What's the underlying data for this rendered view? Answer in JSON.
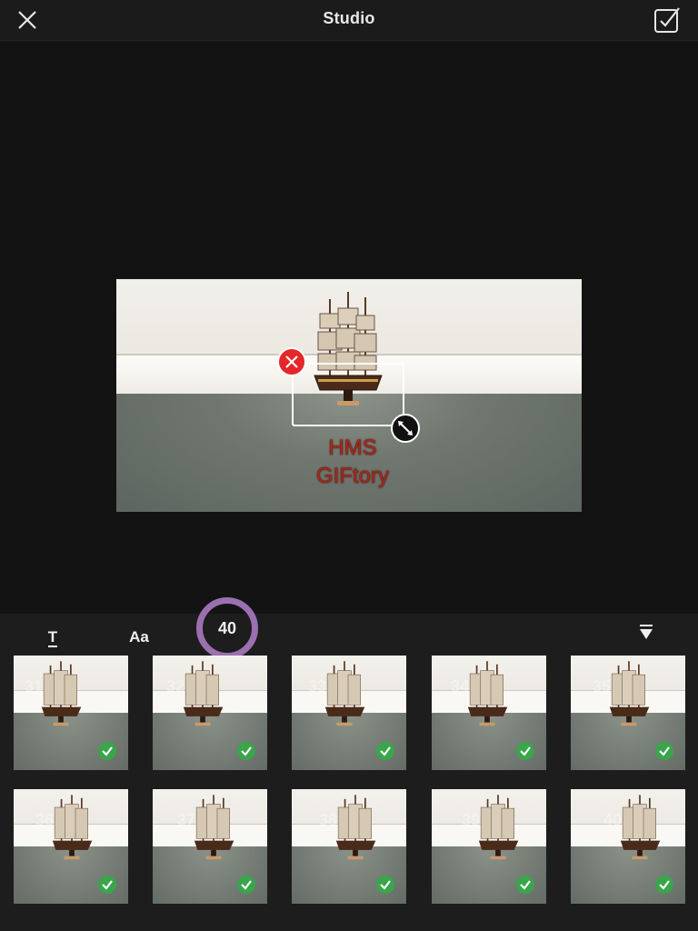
{
  "header": {
    "title": "Studio"
  },
  "preview": {
    "overlay_text_line1": "HMS",
    "overlay_text_line2": "GIFtory",
    "text_color": "#a3291b"
  },
  "toolbar": {
    "text_tool_label": "T",
    "font_tool_label": "Aa",
    "frame_count": "40",
    "accent": "#9b6fb0"
  },
  "frames": [
    {
      "id": 31,
      "selected": true
    },
    {
      "id": 32,
      "selected": true
    },
    {
      "id": 33,
      "selected": true
    },
    {
      "id": 34,
      "selected": true
    },
    {
      "id": 35,
      "selected": true
    },
    {
      "id": 36,
      "selected": true
    },
    {
      "id": 37,
      "selected": true
    },
    {
      "id": 38,
      "selected": true
    },
    {
      "id": 39,
      "selected": true
    },
    {
      "id": 40,
      "selected": true
    }
  ],
  "colors": {
    "check": "#3aa54a",
    "delete": "#e5262a"
  }
}
